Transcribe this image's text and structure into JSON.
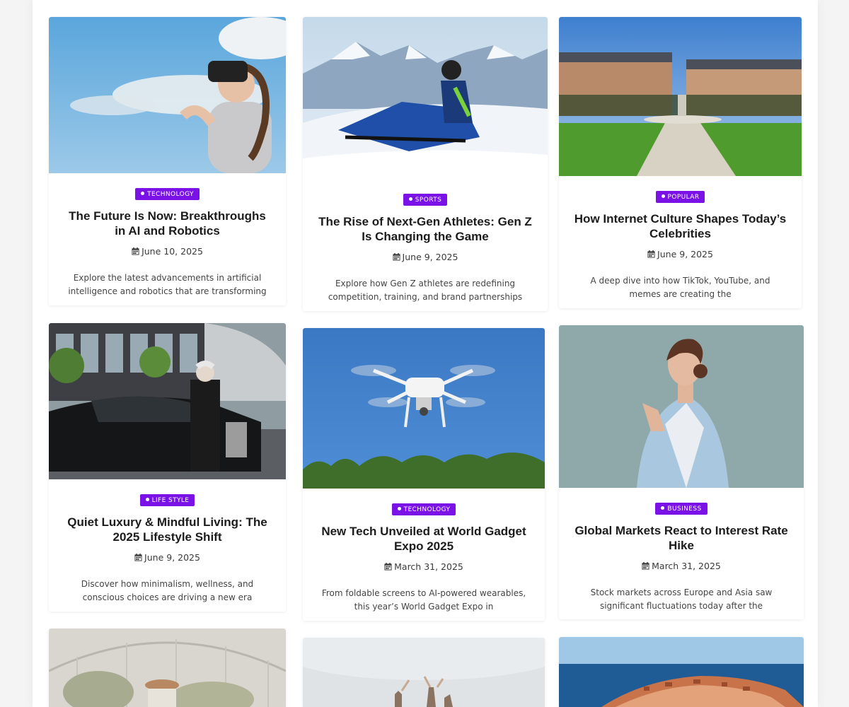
{
  "colors": {
    "accent": "#7a12e8"
  },
  "icons": {
    "date": "calendar-icon",
    "badge_dot": "dot-icon"
  },
  "posts": [
    {
      "category": "TECHNOLOGY",
      "title": "The Future Is Now: Breakthroughs in AI and Robotics",
      "date": "June 10, 2025",
      "excerpt": "Explore the latest advancements in artificial intelligence and robotics that are transforming"
    },
    {
      "category": "SPORTS",
      "title": "The Rise of Next-Gen Athletes: Gen Z Is Changing the Game",
      "date": "June 9, 2025",
      "excerpt": "Explore how Gen Z athletes are redefining competition, training, and brand partnerships"
    },
    {
      "category": "POPULAR",
      "title": "How Internet Culture Shapes Today’s Celebrities",
      "date": "June 9, 2025",
      "excerpt": "A deep dive into how TikTok, YouTube, and memes are creating the"
    },
    {
      "category": "LIFE STYLE",
      "title": "Quiet Luxury & Mindful Living: The 2025 Lifestyle Shift",
      "date": "June 9, 2025",
      "excerpt": "Discover how minimalism, wellness, and conscious choices are driving a new era"
    },
    {
      "category": "TECHNOLOGY",
      "title": "New Tech Unveiled at World Gadget Expo 2025",
      "date": "March 31, 2025",
      "excerpt": "From foldable screens to AI-powered wearables, this year’s World Gadget Expo in"
    },
    {
      "category": "BUSINESS",
      "title": "Global Markets React to Interest Rate Hike",
      "date": "March 31, 2025",
      "excerpt": "Stock markets across Europe and Asia saw significant fluctuations today after the"
    }
  ]
}
